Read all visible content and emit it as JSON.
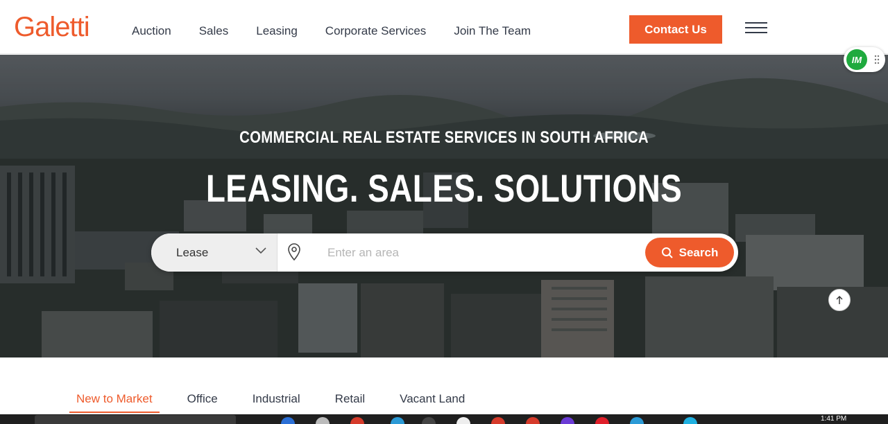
{
  "brand": {
    "logo_text": "Galetti",
    "accent_color": "#ee5b2c"
  },
  "nav": {
    "items": [
      {
        "label": "Auction"
      },
      {
        "label": "Sales"
      },
      {
        "label": "Leasing"
      },
      {
        "label": "Corporate Services"
      },
      {
        "label": "Join The Team"
      }
    ],
    "contact_label": "Contact Us",
    "menu_icon": "hamburger-icon"
  },
  "hero": {
    "subtitle": "COMMERCIAL REAL ESTATE SERVICES IN SOUTH AFRICA",
    "title": "LEASING. SALES. SOLUTIONS",
    "search": {
      "type_selected": "Lease",
      "area_placeholder": "Enter an area",
      "search_label": "Search"
    }
  },
  "extension": {
    "badge_text": "IM",
    "badge_color": "#1faa3e"
  },
  "tabs": [
    {
      "label": "New to Market",
      "active": true
    },
    {
      "label": "Office",
      "active": false
    },
    {
      "label": "Industrial",
      "active": false
    },
    {
      "label": "Retail",
      "active": false
    },
    {
      "label": "Vacant Land",
      "active": false
    }
  ],
  "taskbar": {
    "time": "1:41 PM"
  }
}
